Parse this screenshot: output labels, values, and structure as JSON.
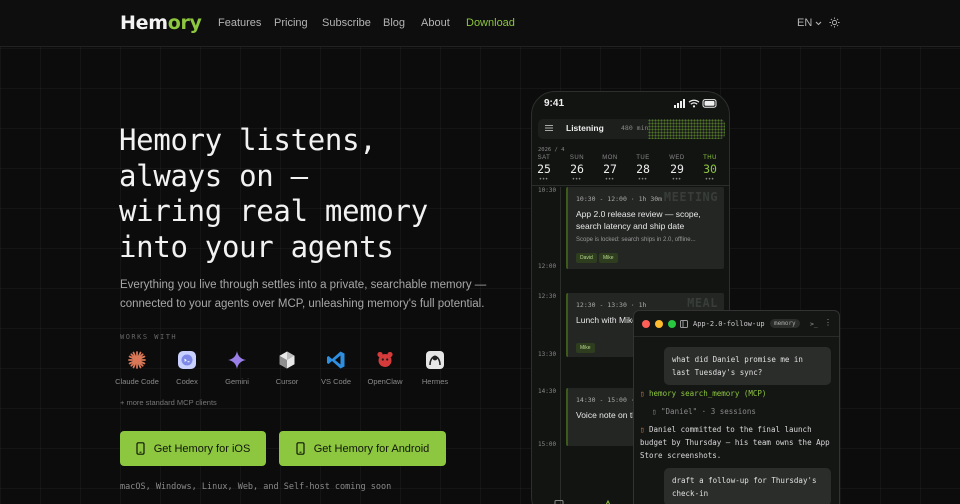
{
  "brand": {
    "logo_main": "Hem",
    "logo_accent": "ory",
    "accent_color": "#8dc63f"
  },
  "nav": {
    "features": "Features",
    "pricing": "Pricing",
    "subscribe": "Subscribe",
    "blog": "Blog",
    "about": "About",
    "download": "Download",
    "language": "EN"
  },
  "hero": {
    "title_lines": [
      "Hemory listens,",
      "always on —",
      "wiring real memory",
      "into your agents"
    ],
    "subtitle": "Everything you live through settles into a private, searchable memory — connected to your agents over MCP, unleashing memory's full potential.",
    "works_with_label": "WORKS WITH",
    "clients": [
      "Claude Code",
      "Codex",
      "Gemini",
      "Cursor",
      "VS Code",
      "OpenClaw",
      "Hermes"
    ],
    "more_clients": "+ more standard MCP clients",
    "ios_button": "Get Hemory for iOS",
    "android_button": "Get Hemory for Android",
    "coming_soon": "macOS, Windows, Linux, Web, and Self-host coming soon"
  },
  "phone": {
    "time": "9:41",
    "listening_label": "Listening",
    "listening_minutes": "480 min",
    "date_label": "2026 / 4",
    "days": [
      {
        "name": "SAT",
        "date": "25"
      },
      {
        "name": "SUN",
        "date": "26"
      },
      {
        "name": "MON",
        "date": "27"
      },
      {
        "name": "TUE",
        "date": "28"
      },
      {
        "name": "WED",
        "date": "29"
      },
      {
        "name": "THU",
        "date": "30"
      }
    ],
    "day_dots": "•••",
    "times": [
      "10:30",
      "12:00",
      "12:30",
      "13:30",
      "14:30",
      "15:00"
    ],
    "events": [
      {
        "time": "10:30 - 12:00 · 1h 30m",
        "watermark": "MEETING",
        "title": "App 2.0 release review — scope, search latency and ship date",
        "detail": "Scope is locked: search ships in 2.0, offline...",
        "tags": [
          "David",
          "Mike"
        ]
      },
      {
        "time": "12:30 - 13:30 · 1h",
        "watermark": "MEAL",
        "title": "Lunch with Mike",
        "tags": [
          "Mike"
        ]
      },
      {
        "time": "14:30 - 15:00 · 30m",
        "title": "Voice note on the"
      }
    ]
  },
  "terminal": {
    "title": "App-2.0-follow-up",
    "badge": "memory",
    "shell": ">_",
    "menu": "⋮",
    "user_msg_1": "what did Daniel promise me in last Tuesday's sync?",
    "tool_call": "hemory search_memory (MCP)",
    "tool_result": "\"Daniel\" · 3 sessions",
    "answer": "Daniel committed to the final launch budget by Thursday — his team owns the App Store screenshots.",
    "user_msg_2": "draft a follow-up for Thursday's check-in"
  }
}
